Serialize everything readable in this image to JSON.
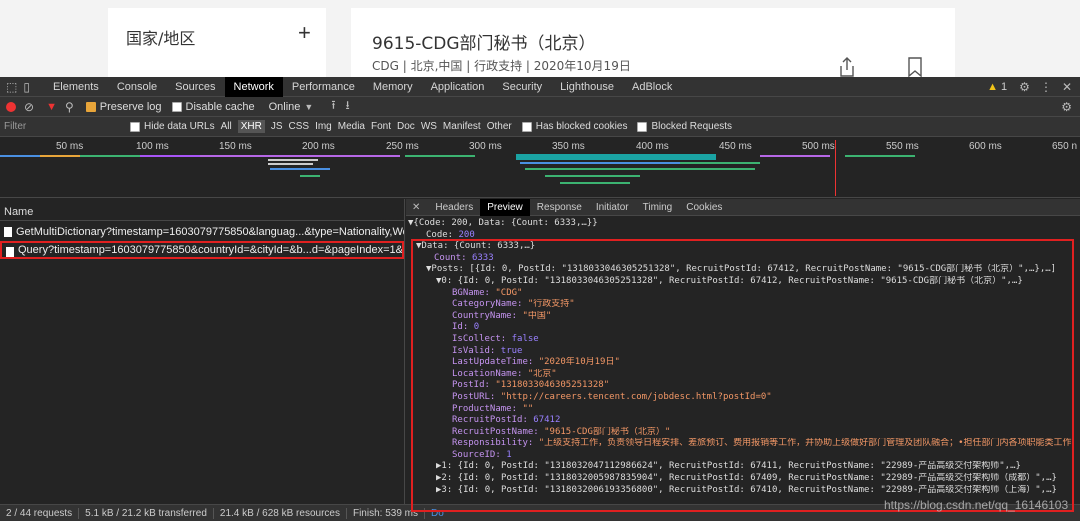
{
  "page": {
    "region_label": "国家/地区",
    "region_plus": "+",
    "job_title": "9615-CDG部门秘书（北京）",
    "job_meta": "CDG | 北京,中国 | 行政支持 | 2020年10月19日"
  },
  "devtools": {
    "tabs": [
      "Elements",
      "Console",
      "Sources",
      "Network",
      "Performance",
      "Memory",
      "Application",
      "Security",
      "Lighthouse",
      "AdBlock"
    ],
    "active_tab": "Network",
    "warning_count": "1",
    "preserve_log": "Preserve log",
    "disable_cache": "Disable cache",
    "throttle": "Online",
    "filter_placeholder": "Filter",
    "hide_data_urls": "Hide data URLs",
    "filter_types": [
      "All",
      "XHR",
      "JS",
      "CSS",
      "Img",
      "Media",
      "Font",
      "Doc",
      "WS",
      "Manifest",
      "Other"
    ],
    "active_filter": "XHR",
    "has_blocked_cookies": "Has blocked cookies",
    "blocked_requests": "Blocked Requests",
    "timeline_ticks": [
      "50 ms",
      "100 ms",
      "150 ms",
      "200 ms",
      "250 ms",
      "300 ms",
      "350 ms",
      "400 ms",
      "450 ms",
      "500 ms",
      "550 ms",
      "600 ms",
      "650 n"
    ],
    "name_header": "Name",
    "requests": [
      "GetMultiDictionary?timestamp=1603079775850&languag...&type=Nationality,WorkPlace,Out...",
      "Query?timestamp=1603079775850&countryId=&cityId=&b...d=&pageIndex=1&pageSize=1..."
    ],
    "detail_tabs": [
      "Headers",
      "Preview",
      "Response",
      "Initiator",
      "Timing",
      "Cookies"
    ],
    "active_detail_tab": "Preview",
    "status": {
      "requests": "2 / 44 requests",
      "transferred": "5.1 kB / 21.2 kB transferred",
      "resources": "21.4 kB / 628 kB resources",
      "finish": "Finish: 539 ms",
      "extra": "Do"
    }
  },
  "preview": {
    "l1": "▼{Code: 200, Data: {Count: 6333,…}}",
    "l2k": "Code: ",
    "l2v": "200",
    "l3": "▼Data: {Count: 6333,…}",
    "l4k": "Count: ",
    "l4v": "6333",
    "l5": "▼Posts: [{Id: 0, PostId: \"1318033046305251328\", RecruitPostId: 67412, RecruitPostName: \"9615-CDG部门秘书（北京）\",…},…]",
    "l6": "▼0: {Id: 0, PostId: \"1318033046305251328\", RecruitPostId: 67412, RecruitPostName: \"9615-CDG部门秘书（北京）\",…}",
    "fields": [
      {
        "k": "BGName: ",
        "v": "\"CDG\"",
        "c": "s"
      },
      {
        "k": "CategoryName: ",
        "v": "\"行政支持\"",
        "c": "s"
      },
      {
        "k": "CountryName: ",
        "v": "\"中国\"",
        "c": "s"
      },
      {
        "k": "Id: ",
        "v": "0",
        "c": "n"
      },
      {
        "k": "IsCollect: ",
        "v": "false",
        "c": "b"
      },
      {
        "k": "IsValid: ",
        "v": "true",
        "c": "b"
      },
      {
        "k": "LastUpdateTime: ",
        "v": "\"2020年10月19日\"",
        "c": "s"
      },
      {
        "k": "LocationName: ",
        "v": "\"北京\"",
        "c": "s"
      },
      {
        "k": "PostId: ",
        "v": "\"1318033046305251328\"",
        "c": "s"
      },
      {
        "k": "PostURL: ",
        "v": "\"http://careers.tencent.com/jobdesc.html?postId=0\"",
        "c": "s"
      },
      {
        "k": "ProductName: ",
        "v": "\"\"",
        "c": "s"
      },
      {
        "k": "RecruitPostId: ",
        "v": "67412",
        "c": "n"
      },
      {
        "k": "RecruitPostName: ",
        "v": "\"9615-CDG部门秘书（北京）\"",
        "c": "s"
      },
      {
        "k": "Responsibility: ",
        "v": "\"上级支持工作，负责领导日程安排、差旅预订、费用报销等工作，并协助上级做好部门管理及团队融合；•担任部门内各项职能类工作",
        "c": "s"
      },
      {
        "k": "SourceID: ",
        "v": "1",
        "c": "n"
      }
    ],
    "l1x": "▶1: {Id: 0, PostId: \"1318032047112986624\", RecruitPostId: 67411, RecruitPostName: \"22989-产品高级交付架构师\",…}",
    "l2x": "▶2: {Id: 0, PostId: \"1318032005987835904\", RecruitPostId: 67409, RecruitPostName: \"22989-产品高级交付架构师（成都）\",…}",
    "l3x": "▶3: {Id: 0, PostId: \"1318032006193356800\", RecruitPostId: 67410, RecruitPostName: \"22989-产品高级交付架构师（上海）\",…}"
  },
  "watermark": "https://blog.csdn.net/qq_16146103",
  "colors": {
    "highlight": "#e02020",
    "accent": "#e8a53a"
  }
}
